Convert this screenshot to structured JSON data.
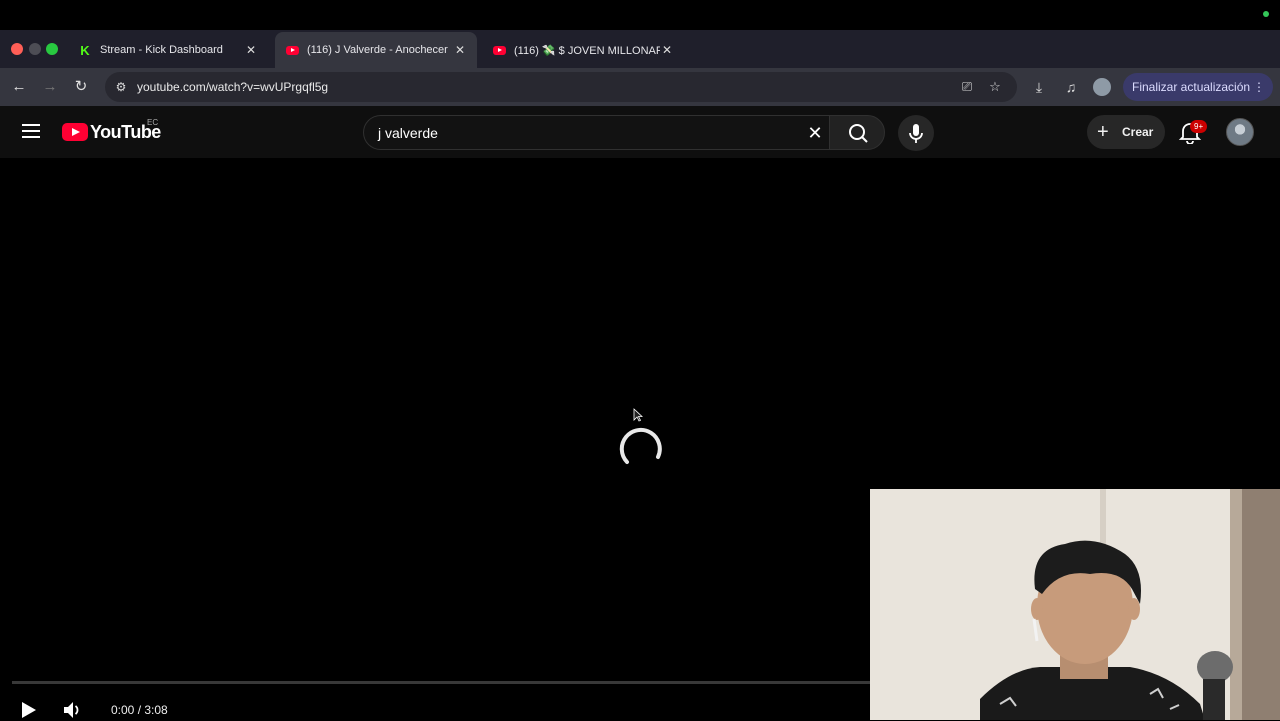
{
  "browser": {
    "tabs": [
      {
        "title": "Stream - Kick Dashboard",
        "favicon": "kick-icon",
        "active": false
      },
      {
        "title": "(116) J Valverde - Anochecer",
        "favicon": "youtube-icon",
        "active": true
      },
      {
        "title": "(116) 💸 $ JOVEN MILLONARI",
        "favicon": "youtube-icon",
        "active": false
      }
    ],
    "url": "youtube.com/watch?v=wvUPrgqfl5g",
    "update_button_label": "Finalizar actualización"
  },
  "youtube": {
    "logo_text": "YouTube",
    "country_code": "EC",
    "search_query": "j valverde",
    "create_label": "Crear",
    "notification_badge": "9+"
  },
  "player": {
    "time_display": "0:00 / 3:08",
    "state": "loading",
    "progress": 0
  },
  "colors": {
    "youtube_red": "#ff0033",
    "kick_green": "#53fc18",
    "tabstrip_bg": "#1f1f2b",
    "toolbar_bg": "#35363f",
    "update_button_bg": "#3a3a6a"
  }
}
